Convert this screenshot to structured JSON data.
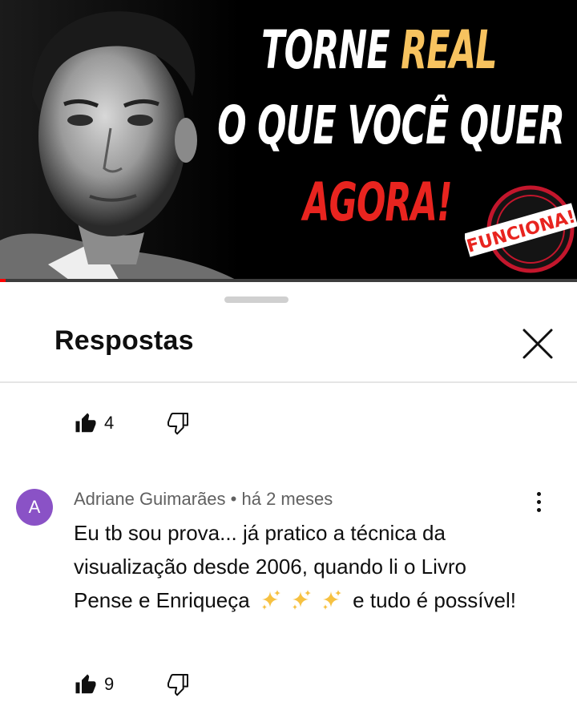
{
  "video": {
    "headline_line1_a": "TORNE ",
    "headline_line1_b": "REAL",
    "headline_line2": "O QUE VOCÊ QUER",
    "headline_line3": "AGORA!",
    "stamp_text": "FUNCIONA!",
    "progress_fraction": 0.01
  },
  "sheet": {
    "title": "Respostas"
  },
  "previous_comment": {
    "like_count": "4"
  },
  "comment": {
    "avatar_letter": "A",
    "author": "Adriane Guimarães",
    "separator": " • ",
    "time_ago": "há 2 meses",
    "text_before_sparkles": "Eu tb sou prova... já pratico a técnica da visualização desde 2006, quando li o Livro Pense e Enriqueça ",
    "text_after_sparkles": " e tudo é possível!",
    "like_count": "9"
  },
  "colors": {
    "accent_yellow": "#f7c35f",
    "accent_red": "#e8241f",
    "avatar_bg": "#8a52c6"
  },
  "icons": [
    "thumb-up-icon",
    "thumb-down-icon",
    "close-icon",
    "more-vert-icon",
    "sparkles-emoji"
  ]
}
